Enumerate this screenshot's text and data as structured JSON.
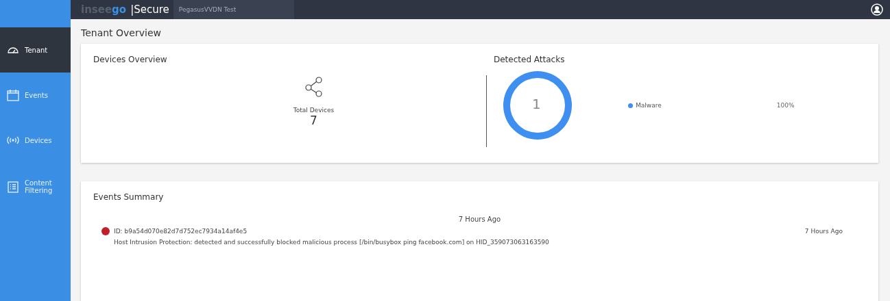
{
  "header": {
    "logo": {
      "faint": "insee",
      "accent": "go"
    },
    "product": "|Secure",
    "tenant_field": {
      "value": "PegasusVVDN Test"
    }
  },
  "sidebar": {
    "items": [
      {
        "label": "Tenant",
        "selected": true
      },
      {
        "label": "Events",
        "selected": false
      },
      {
        "label": "Devices",
        "selected": false
      },
      {
        "label": "Content Filtering",
        "selected": false
      }
    ]
  },
  "page_title": "Tenant Overview",
  "devices_overview": {
    "title": "Devices Overview",
    "label": "Total Devices",
    "count": "7"
  },
  "detected_attacks": {
    "title": "Detected Attacks",
    "total": "1",
    "legend": [
      {
        "label": "Malware",
        "value": "100%",
        "color": "#3f8ff0"
      }
    ]
  },
  "events_summary": {
    "title": "Events Summary",
    "group_time": "7 Hours Ago",
    "events": [
      {
        "id": "ID: b9a54d070e82d7d752ec7934a14af4e5",
        "color": "#c0202a",
        "time": "7 Hours Ago",
        "description": "Host Intrusion Protection: detected and successfully blocked malicious process [/bin/busybox ping facebook.com] on HID_359073063163590"
      }
    ]
  }
}
